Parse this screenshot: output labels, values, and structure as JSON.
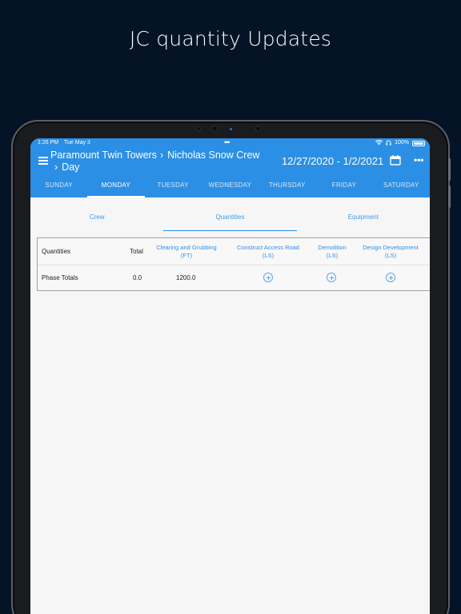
{
  "promo": {
    "title": "JC quantity Updates"
  },
  "status_bar": {
    "time": "1:26 PM",
    "date": "Tue May 3",
    "battery": "100%",
    "battery_level": 1.0
  },
  "header": {
    "breadcrumb": [
      "Paramount Twin Towers",
      "Nicholas Snow Crew",
      "Day"
    ],
    "date_range": "12/27/2020 - 1/2/2021"
  },
  "day_tabs": [
    {
      "label": "SUNDAY",
      "active": false
    },
    {
      "label": "MONDAY",
      "active": true
    },
    {
      "label": "TUESDAY",
      "active": false
    },
    {
      "label": "WEDNESDAY",
      "active": false
    },
    {
      "label": "THURSDAY",
      "active": false
    },
    {
      "label": "FRIDAY",
      "active": false
    },
    {
      "label": "SATURDAY",
      "active": false
    }
  ],
  "sub_tabs": [
    {
      "label": "Crew",
      "active": false
    },
    {
      "label": "Quantities",
      "active": true
    },
    {
      "label": "Equipment",
      "active": false
    }
  ],
  "table": {
    "row_header": "Quantities",
    "total_header": "Total",
    "columns": [
      {
        "name": "Clearing and Grubbing",
        "unit": "(FT)"
      },
      {
        "name": "Construct Access Road",
        "unit": "(LS)"
      },
      {
        "name": "Demolition",
        "unit": "(LS)"
      },
      {
        "name": "Design Development",
        "unit": "(LS)"
      }
    ],
    "rows": [
      {
        "label": "Phase Totals",
        "total": "0.0",
        "values": [
          "1200.0",
          "",
          "",
          ""
        ]
      }
    ]
  },
  "colors": {
    "accent": "#2b8fe6",
    "background": "#041426"
  }
}
